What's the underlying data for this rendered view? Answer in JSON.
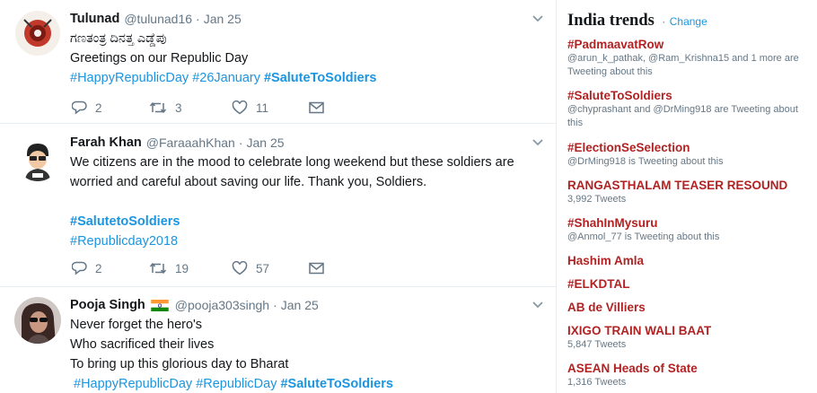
{
  "tweets": [
    {
      "name": "Tulunad",
      "handle": "@tulunad16",
      "time": "Jan 25",
      "lines": [
        "ಗಣತಂತ್ರ ದಿನತ್ತ ಎಡ್ಡೆಪು",
        "Greetings on our Republic Day"
      ],
      "hashtags": [
        "#HappyRepublicDay",
        "#26January",
        "#SaluteToSoldiers"
      ],
      "replies": "2",
      "retweets": "3",
      "likes": "11"
    },
    {
      "name": "Farah Khan",
      "handle": "@FaraaahKhan",
      "time": "Jan 25",
      "lines": [
        "We citizens are in the mood to celebrate long weekend but these soldiers are",
        "worried and careful about saving our life. Thank you, Soldiers."
      ],
      "hashtags": [
        "#SalutetoSoldiers",
        "#Republicday2018"
      ],
      "replies": "2",
      "retweets": "19",
      "likes": "57"
    },
    {
      "name": "Pooja Singh",
      "handle": "@pooja303singh",
      "time": "Jan 25",
      "lines": [
        "Never forget the hero's",
        "Who sacrificed their lives",
        "To bring up this glorious day to Bharat"
      ],
      "hashtags": [
        "#HappyRepublicDay",
        "#RepublicDay",
        "#SaluteToSoldiers"
      ]
    }
  ],
  "trends": {
    "title": "India trends",
    "separator": "·",
    "change": "Change",
    "items": [
      {
        "name": "#PadmaavatRow",
        "meta": "@arun_k_pathak, @Ram_Krishna15 and 1 more are Tweeting about this"
      },
      {
        "name": "#SaluteToSoldiers",
        "meta": "@chyprashant and @DrMing918 are Tweeting about this"
      },
      {
        "name": "#ElectionSeSelection",
        "meta": "@DrMing918 is Tweeting about this"
      },
      {
        "name": "RANGASTHALAM TEASER RESOUND",
        "meta": "3,992 Tweets"
      },
      {
        "name": "#ShahInMysuru",
        "meta": "@Anmol_77 is Tweeting about this"
      },
      {
        "name": "Hashim Amla",
        "meta": ""
      },
      {
        "name": "#ELKDTAL",
        "meta": ""
      },
      {
        "name": "AB de Villiers",
        "meta": ""
      },
      {
        "name": "IXIGO TRAIN WALI BAAT",
        "meta": "5,847 Tweets"
      },
      {
        "name": "ASEAN Heads of State",
        "meta": "1,316 Tweets"
      }
    ]
  },
  "colors": {
    "link": "#1b95e0",
    "trend": "#b22222",
    "muted": "#657786"
  },
  "icons": [
    "reply-icon",
    "retweet-icon",
    "like-icon",
    "message-icon",
    "chevron-down-icon"
  ]
}
